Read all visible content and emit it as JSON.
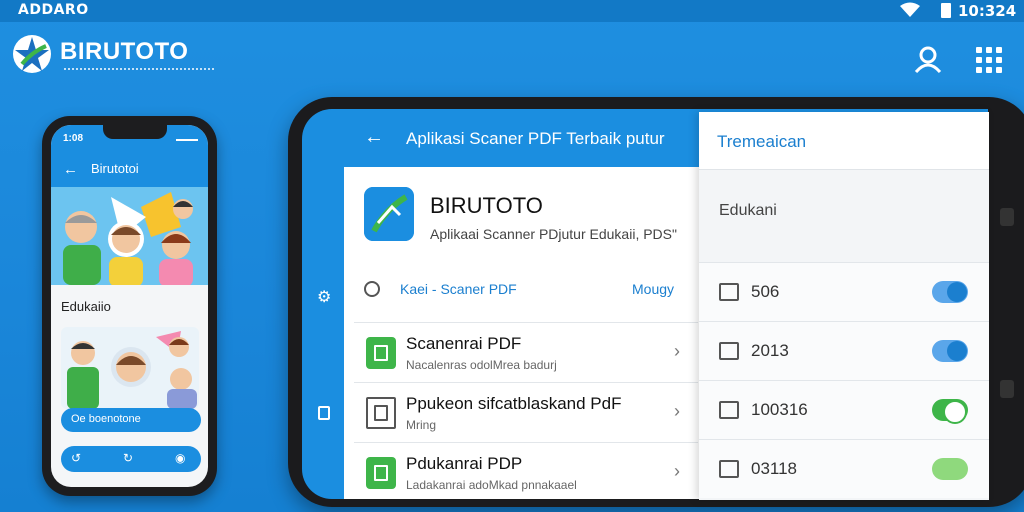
{
  "statusbar": {
    "carrier": "ADDARO",
    "time": "10:324"
  },
  "brand": {
    "name": "BIRUTOTO"
  },
  "small_phone": {
    "status_time": "1:08",
    "title": "Birutotoi",
    "section_label": "Edukaiio",
    "button_label": "Oe boenotone",
    "nav": [
      "↺",
      "↻",
      "◉"
    ]
  },
  "big_phone": {
    "appbar_title": "Aplikasi Scaner PDF Terbaik putur",
    "app": {
      "name": "BIRUTOTO",
      "desc": "Aplikaai Scanner PDjutur Edukaii, PDS\""
    },
    "search_row": {
      "label": "Kaei - Scaner PDF",
      "more": "Mougy"
    },
    "items": [
      {
        "title": "Scanenrai PDF",
        "subtitle": "Nacalenras odolMrea badurj"
      },
      {
        "title": "Ppukeon sifcatblaskand PdF",
        "subtitle": "Mring"
      },
      {
        "title": "Pdukanrai PDP",
        "subtitle": "Ladakanrai adoMkad pnnakaael"
      }
    ]
  },
  "settings": {
    "title": "Tremeaican",
    "section": "Edukani",
    "rows": [
      {
        "value": "506",
        "toggle": "blue"
      },
      {
        "value": "2013",
        "toggle": "blue"
      },
      {
        "value": "100316",
        "toggle": "green"
      },
      {
        "value": "03118",
        "toggle": "lightgreen"
      }
    ]
  },
  "colors": {
    "primary": "#1b8ee0",
    "accent_green": "#3eb549",
    "link": "#1b7fcf"
  }
}
